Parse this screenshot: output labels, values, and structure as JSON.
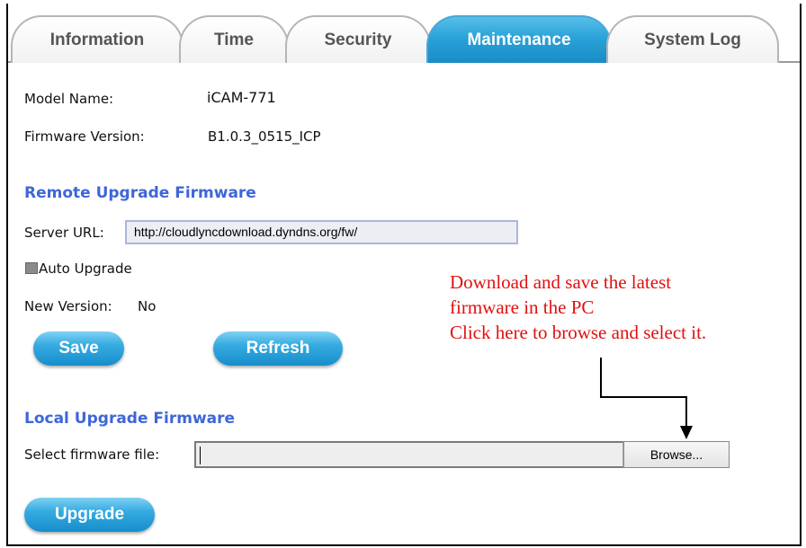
{
  "tabs": [
    {
      "label": "Information",
      "active": false
    },
    {
      "label": "Time",
      "active": false
    },
    {
      "label": "Security",
      "active": false
    },
    {
      "label": "Maintenance",
      "active": true
    },
    {
      "label": "System Log",
      "active": false
    }
  ],
  "device": {
    "model_label": "Model Name:",
    "model_value": "iCAM-771",
    "firmware_label": "Firmware Version:",
    "firmware_value": "B1.0.3_0515_ICP"
  },
  "remote": {
    "title": "Remote Upgrade Firmware",
    "server_url_label": "Server URL:",
    "server_url_value": "http://cloudlyncdownload.dyndns.org/fw/",
    "auto_upgrade_label": "Auto Upgrade",
    "auto_upgrade_checked": false,
    "new_version_label": "New Version:",
    "new_version_value": "No",
    "save_label": "Save",
    "refresh_label": "Refresh"
  },
  "local": {
    "title": "Local Upgrade Firmware",
    "select_label": "Select firmware file:",
    "file_value": "",
    "browse_label": "Browse...",
    "upgrade_label": "Upgrade"
  },
  "annotation": {
    "line1": "Download and save the latest",
    "line2": "firmware in the PC",
    "line3": "Click here to browse and select it."
  },
  "colors": {
    "accent": "#2aa2d8",
    "section_title": "#3f66d8",
    "annotation": "#e01010"
  }
}
